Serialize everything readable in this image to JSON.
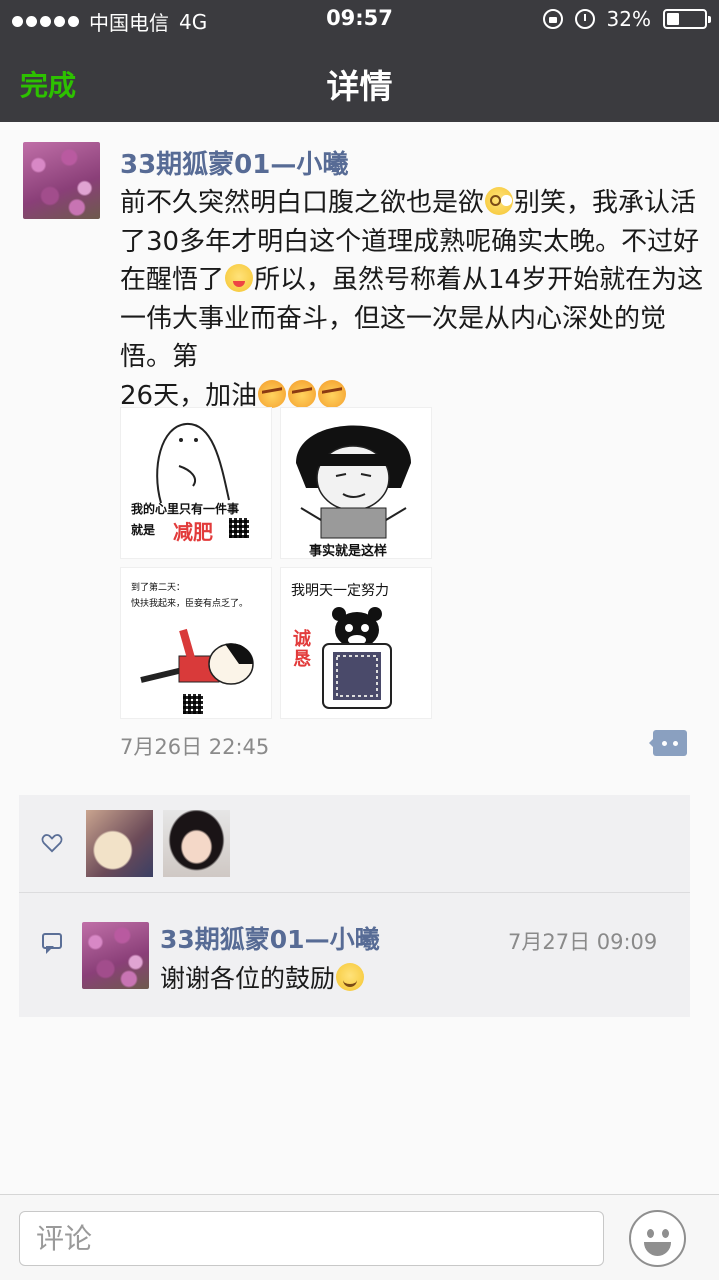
{
  "status_bar": {
    "carrier": "中国电信",
    "network": "4G",
    "time": "09:57",
    "battery_percent": "32%",
    "battery_level": 0.32,
    "icons": [
      "signal-dots-icon",
      "rotation-lock-icon",
      "alarm-icon",
      "battery-icon"
    ]
  },
  "nav": {
    "done_label": "完成",
    "title": "详情"
  },
  "post": {
    "author": "33期狐蒙01—小曦",
    "text_segments": [
      "前不久突然明白口腹之欲也是欲",
      "别笑，我承认活了30多年才明白这个道理成熟呢确实太晚。不过好在醒悟了",
      "所以，虽然号称着从14岁开始就在为这一伟大事业而奋斗，但这一次是从内心深处的觉悟。第",
      "26天，加油"
    ],
    "emojis": [
      "flushed-face-emoji",
      "winking-tongue-emoji",
      "determined-face-emoji"
    ],
    "images": [
      {
        "caption_line1": "我的心里只有一件事",
        "caption_line2": "就是",
        "caption_highlight": "减肥"
      },
      {
        "caption": "事实就是这样"
      },
      {
        "caption_line1": "到了第二天：",
        "caption_line2": "快扶我起来，臣妾有点乏了。"
      },
      {
        "caption": "我明天一定努力",
        "side_text": "诚恳"
      }
    ],
    "time": "7月26日 22:45"
  },
  "likes": {
    "icon": "heart-icon",
    "count_shown": 2
  },
  "comments": [
    {
      "author": "33期狐蒙01—小曦",
      "time": "7月27日 09:09",
      "text": "谢谢各位的鼓励"
    }
  ],
  "input": {
    "placeholder": "评论"
  },
  "colors": {
    "nav_bg": "#3b3b3f",
    "done_green": "#2dc100",
    "name_blue": "#576b95",
    "panel_bg": "#f0f0f2"
  }
}
